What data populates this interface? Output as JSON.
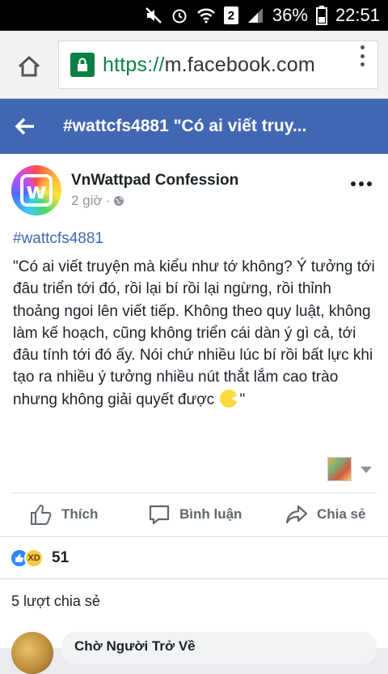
{
  "status_bar": {
    "battery": "36%",
    "time": "22:51",
    "sim_badge": "2"
  },
  "browser": {
    "url_scheme": "https://",
    "url_host": "m.facebook.com"
  },
  "header": {
    "title": "#wattcfs4881 \"Có ai viết truy..."
  },
  "post": {
    "page_name": "VnWattpad Confession",
    "time": "2 giờ",
    "hashtag": "#wattcfs4881",
    "body": "\"Có ai viết truyện mà kiểu như tớ không? Ý tưởng tới đâu triển tới đó, rồi lại bí rồi lại ngừng, rồi thỉnh thoảng ngoi lên viết tiếp. Không theo quy luật, không làm kế hoạch, cũng không triển cái dàn ý gì cả, tới đâu tính tới đó ấy. Nói chứ nhiều lúc bí rồi bất lực khi tạo ra nhiều ý tưởng nhiều nút thắt lắm cao trào nhưng không giải quyết được",
    "body_end": "\""
  },
  "actions": {
    "like": "Thích",
    "comment": "Bình luận",
    "share": "Chia sẻ"
  },
  "reactions": {
    "count": "51"
  },
  "shares": {
    "text": "5 lượt chia sẻ"
  },
  "comment": {
    "author": "Chờ Người Trở Về"
  },
  "colors": {
    "facebook_blue": "#4267b2",
    "secure_green": "#0b8043"
  }
}
